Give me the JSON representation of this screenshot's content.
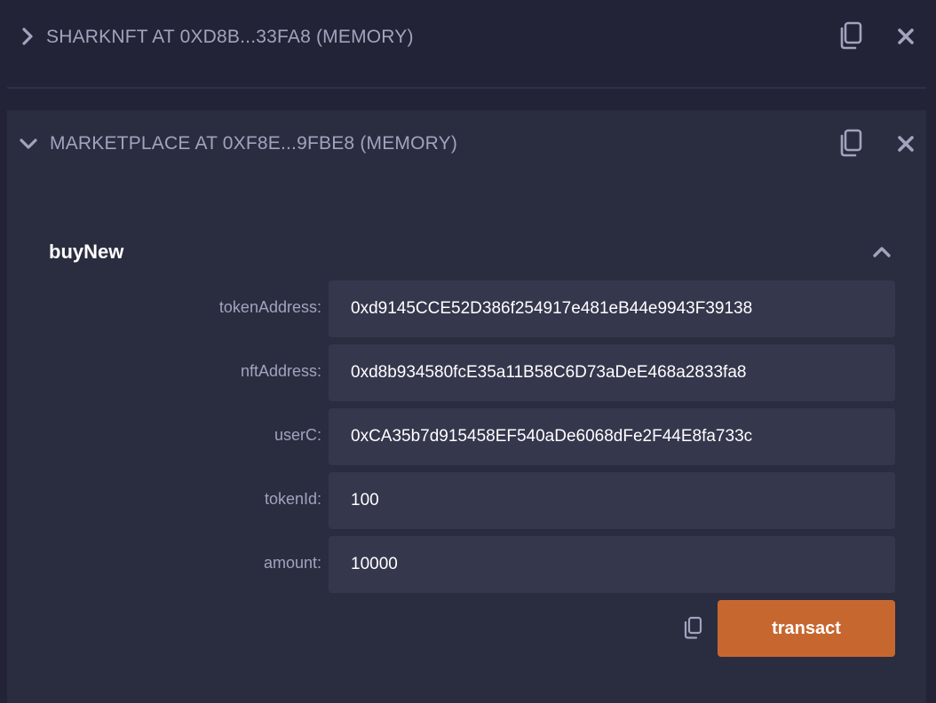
{
  "contracts": [
    {
      "title": "SHARKNFT AT 0XD8B...33FA8 (MEMORY)",
      "expanded": false,
      "icons": {
        "toggle": "chevron-right-icon",
        "copy": "copy-icon",
        "remove": "close-icon"
      }
    },
    {
      "title": "MARKETPLACE AT 0XF8E...9FBE8 (MEMORY)",
      "expanded": true,
      "icons": {
        "toggle": "chevron-down-icon",
        "copy": "copy-icon",
        "remove": "close-icon"
      },
      "function": {
        "name": "buyNew",
        "collapse_icon": "chevron-up-icon",
        "params": [
          {
            "label": "tokenAddress:",
            "value": "0xd9145CCE52D386f254917e481eB44e9943F39138"
          },
          {
            "label": "nftAddress:",
            "value": "0xd8b934580fcE35a11B58C6D73aDeE468a2833fa8"
          },
          {
            "label": "userC:",
            "value": "0xCA35b7d915458EF540aDe6068dFe2F44E8fa733c"
          },
          {
            "label": "tokenId:",
            "value": "100"
          },
          {
            "label": "amount:",
            "value": "10000"
          }
        ],
        "calldata_icon": "copy-icon",
        "transact_label": "transact"
      }
    }
  ],
  "colors": {
    "background": "#222336",
    "panel": "#2a2c3f",
    "input": "#35374d",
    "text_muted": "#a2a3bd",
    "accent": "#c76730"
  }
}
